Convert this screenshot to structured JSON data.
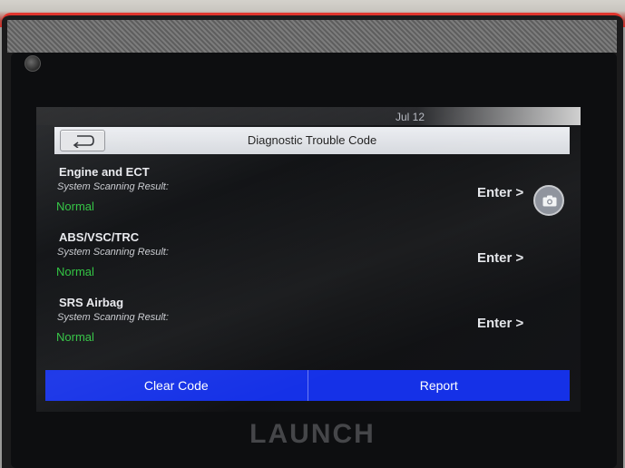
{
  "status_bar": {
    "time": "Jul 12"
  },
  "header": {
    "title": "Diagnostic Trouble Code",
    "back_icon": "back-arrow-icon"
  },
  "systems": [
    {
      "name": "Engine and ECT",
      "caption": "System Scanning Result:",
      "status": "Normal",
      "action": "Enter >"
    },
    {
      "name": "ABS/VSC/TRC",
      "caption": "System Scanning Result:",
      "status": "Normal",
      "action": "Enter >"
    },
    {
      "name": "SRS Airbag",
      "caption": "System Scanning Result:",
      "status": "Normal",
      "action": "Enter >"
    }
  ],
  "side_tools": {
    "camera_icon": "camera-icon"
  },
  "bottom_bar": {
    "clear_code": "Clear Code",
    "report": "Report"
  },
  "device": {
    "brand": "LAUNCH"
  },
  "colors": {
    "accent": "#1531e7",
    "status_ok": "#31c442",
    "device_red": "#d02c27"
  }
}
